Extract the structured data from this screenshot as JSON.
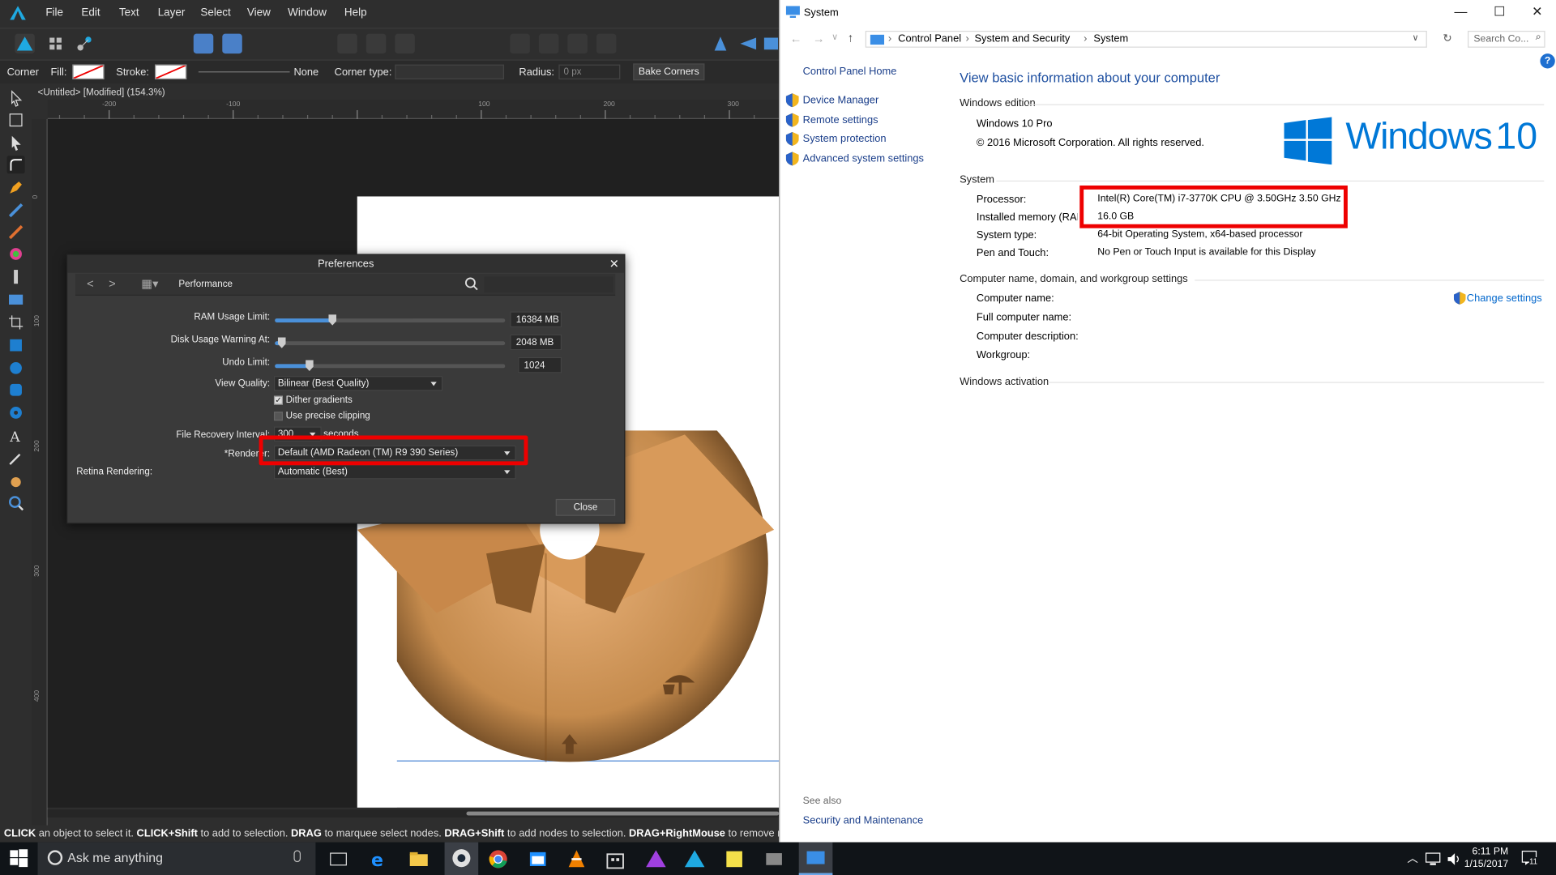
{
  "affinity": {
    "menu": [
      "File",
      "Edit",
      "Text",
      "Layer",
      "Select",
      "View",
      "Window",
      "Help"
    ],
    "context": {
      "corner_label": "Corner",
      "fill_label": "Fill:",
      "stroke_label": "Stroke:",
      "stroke_value": "None",
      "corner_type_label": "Corner type:",
      "radius_label": "Radius:",
      "radius_value": "0 px",
      "bake_button": "Bake Corners"
    },
    "doc_title": "<Untitled> [Modified] (154.3%)",
    "ruler_h": [
      "-200",
      "-100",
      "100",
      "200",
      "300"
    ],
    "ruler_v": [
      "0",
      "100",
      "200",
      "300",
      "400"
    ],
    "status": {
      "p1": "CLICK",
      "p2": " an object to select it. ",
      "p3": "CLICK+Shift",
      "p4": " to add to selection. ",
      "p5": "DRAG",
      "p6": " to marquee select nodes. ",
      "p7": "DRAG+Shift",
      "p8": " to add nodes to selection. ",
      "p9": "DRAG+RightMouse",
      "p10": " to remove nodes from se"
    },
    "preferences": {
      "title": "Preferences",
      "close_x": "✕",
      "section": "Performance",
      "ram_label": "RAM Usage Limit:",
      "ram_value": "16384 MB",
      "ram_fill": 0.25,
      "disk_label": "Disk Usage Warning At:",
      "disk_value": "2048 MB",
      "disk_fill": 0.03,
      "undo_label": "Undo Limit:",
      "undo_value": "1024",
      "undo_fill": 0.15,
      "view_quality_label": "View Quality:",
      "view_quality_value": "Bilinear (Best Quality)",
      "dither_label": "Dither gradients",
      "dither_checked": "✓",
      "clipping_label": "Use precise clipping",
      "recovery_label": "File Recovery Interval:",
      "recovery_value": "300",
      "recovery_unit": "seconds",
      "renderer_label": "*Renderer:",
      "renderer_value": "Default (AMD Radeon (TM) R9 390 Series)",
      "retina_label": "Retina Rendering:",
      "retina_value": "Automatic (Best)",
      "close_button": "Close"
    }
  },
  "system": {
    "title": "System",
    "controls": {
      "min": "—",
      "max": "☐",
      "close": "✕"
    },
    "breadcrumb": [
      "Control Panel",
      "System and Security",
      "System"
    ],
    "search_placeholder": "Search Co...",
    "sidebar": {
      "home": "Control Panel Home",
      "links": [
        "Device Manager",
        "Remote settings",
        "System protection",
        "Advanced system settings"
      ],
      "see_also": "See also",
      "security": "Security and Maintenance"
    },
    "heading": "View basic information about your computer",
    "edition_section": "Windows edition",
    "edition": "Windows 10 Pro",
    "copyright": "© 2016 Microsoft Corporation. All rights reserved.",
    "logo_text": "Windows",
    "logo_number": "10",
    "system_section": "System",
    "rows": [
      {
        "label": "Processor:",
        "value": "Intel(R) Core(TM) i7-3770K CPU @ 3.50GHz   3.50 GHz"
      },
      {
        "label": "Installed memory (RAM):",
        "value": "16.0 GB"
      },
      {
        "label": "System type:",
        "value": "64-bit Operating System, x64-based processor"
      },
      {
        "label": "Pen and Touch:",
        "value": "No Pen or Touch Input is available for this Display"
      }
    ],
    "name_section": "Computer name, domain, and workgroup settings",
    "name_rows": [
      "Computer name:",
      "Full computer name:",
      "Computer description:",
      "Workgroup:"
    ],
    "change_settings": "Change settings",
    "activation_section": "Windows activation"
  },
  "taskbar": {
    "search": "Ask me anything",
    "time": "6:11 PM",
    "date": "1/15/2017",
    "notif_count": "11"
  },
  "colors": {
    "accent_blue": "#0078d7",
    "red_highlight": "#e00000",
    "link_blue": "#0066cc"
  }
}
